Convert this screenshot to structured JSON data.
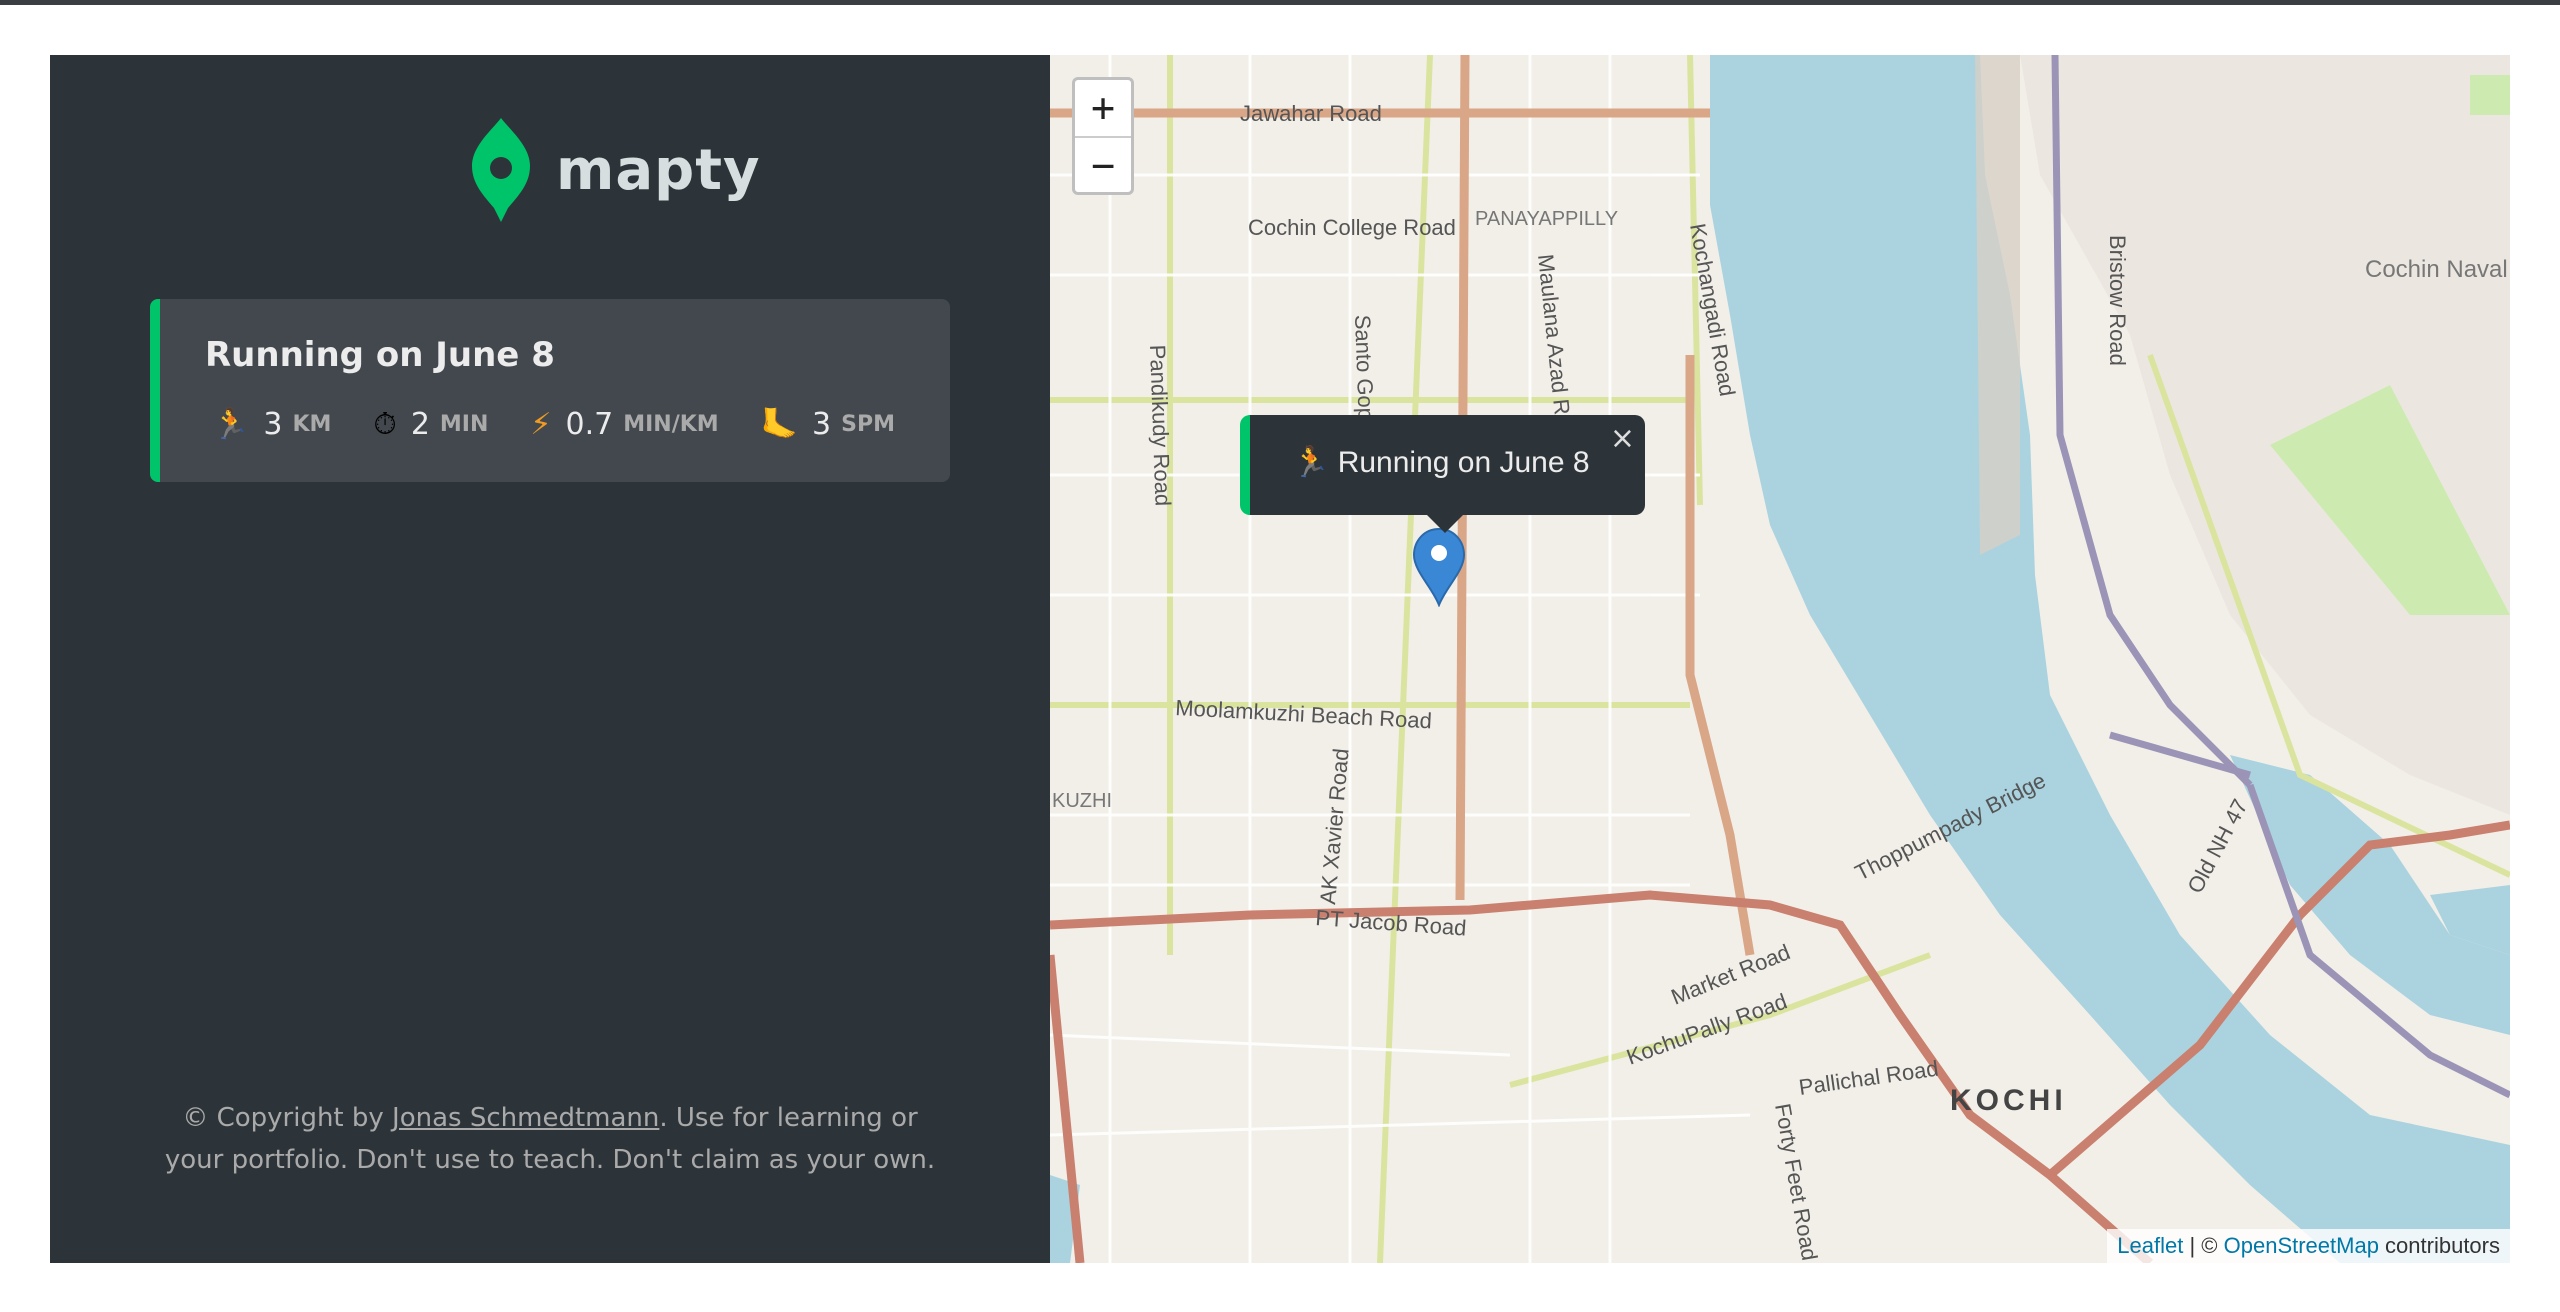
{
  "app": {
    "logo_text": "mapty"
  },
  "workouts": [
    {
      "title": "Running on June 8",
      "type": "running",
      "accent_color": "#00c46a",
      "details": [
        {
          "icon": "runner-icon",
          "glyph": "🏃",
          "value": "3",
          "unit": "km"
        },
        {
          "icon": "stopwatch-icon",
          "glyph": "⏱",
          "value": "2",
          "unit": "min"
        },
        {
          "icon": "lightning-icon",
          "glyph": "⚡",
          "value": "0.7",
          "unit": "min/km"
        },
        {
          "icon": "footprint-icon",
          "glyph": "🦶",
          "value": "3",
          "unit": "spm"
        }
      ]
    }
  ],
  "footer": {
    "prefix": "© Copyright by ",
    "author": "Jonas Schmedtmann",
    "suffix": ". Use for learning or your portfolio. Don't use to teach. Don't claim as your own."
  },
  "map": {
    "zoom_in": "+",
    "zoom_out": "−",
    "popup": {
      "glyph": "🏃",
      "text": "Running on June 8",
      "close": "×"
    },
    "attribution": {
      "leaflet": "Leaflet",
      "separator": " | © ",
      "osm": "OpenStreetMap",
      "suffix": " contributors"
    },
    "labels": [
      "Jawahar Road",
      "Cochin College Road",
      "PANAYAPPILLY",
      "Pandikudy Road",
      "Maulana Azad Road",
      "Kochangadi Road",
      "Bristow Road",
      "Cochin Naval Base",
      "Santo Gop",
      "Moolamkuzhi Beach Road",
      "AK Xavier Road",
      "PT Jacob Road",
      "KUZHI",
      "Thoppumpady Bridge",
      "Old NH 47",
      "Market Road",
      "KochuPally Road",
      "Pallichal Road",
      "KOCHI",
      "Forty Feet Road"
    ],
    "colors": {
      "land": "#f2efe9",
      "water": "#aad3df",
      "primary_road": "#d9a688",
      "trunk_road": "#c9806f",
      "secondary_road": "#dbe49f",
      "rail": "#9b94b7"
    }
  }
}
